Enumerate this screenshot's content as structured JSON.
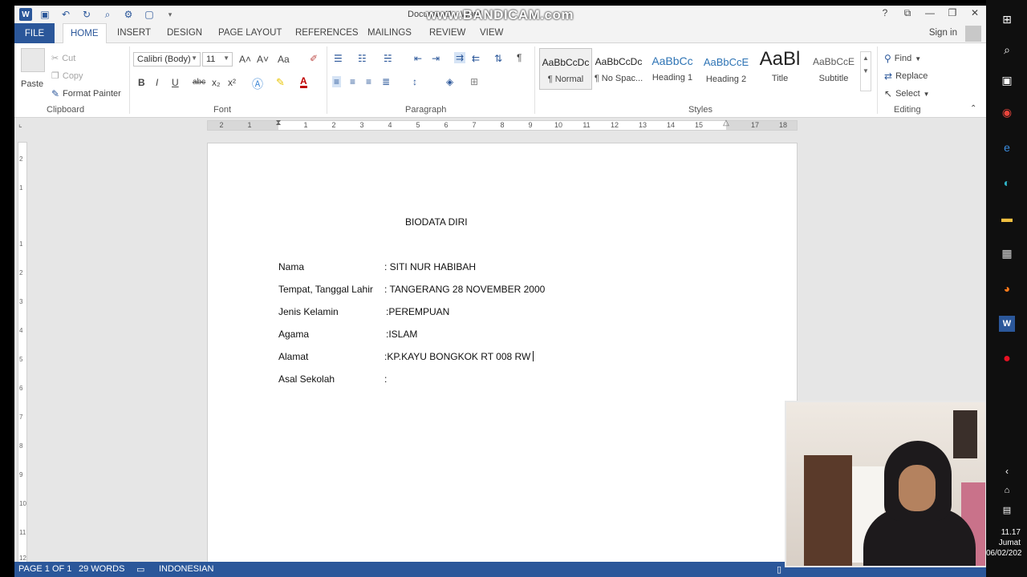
{
  "window": {
    "title": "Document1 - Word",
    "watermark": "www.BANDICAM.com",
    "controls": [
      "?",
      "⧉",
      "—",
      "❐",
      "✕"
    ]
  },
  "tabs": {
    "file": "FILE",
    "items": [
      "HOME",
      "INSERT",
      "DESIGN",
      "PAGE LAYOUT",
      "REFERENCES",
      "MAILINGS",
      "REVIEW",
      "VIEW"
    ],
    "signin": "Sign in"
  },
  "ribbon": {
    "clipboard": {
      "label": "Clipboard",
      "paste": "Paste",
      "cut": "Cut",
      "copy": "Copy",
      "format_painter": "Format Painter"
    },
    "font": {
      "label": "Font",
      "name": "Calibri (Body)",
      "size": "11",
      "bold": "B",
      "italic": "I",
      "underline": "U",
      "strike": "abc",
      "sub": "x₂",
      "sup": "x²",
      "grow": "A˄",
      "shrink": "A˅",
      "case": "Aa",
      "color": "A"
    },
    "paragraph": {
      "label": "Paragraph",
      "pilcrow": "¶"
    },
    "styles": {
      "label": "Styles",
      "items": [
        {
          "preview": "AaBbCcDc",
          "name": "¶ Normal"
        },
        {
          "preview": "AaBbCcDc",
          "name": "¶ No Spac..."
        },
        {
          "preview": "AaBbCc",
          "name": "Heading 1"
        },
        {
          "preview": "AaBbCcE",
          "name": "Heading 2"
        },
        {
          "preview": "AaBl",
          "name": "Title"
        },
        {
          "preview": "AaBbCcE",
          "name": "Subtitle"
        }
      ]
    },
    "editing": {
      "label": "Editing",
      "find": "Find",
      "replace": "Replace",
      "select": "Select"
    }
  },
  "ruler": {
    "ticks": [
      "2",
      "1",
      "1",
      "2",
      "3",
      "4",
      "5",
      "6",
      "7",
      "8",
      "9",
      "10",
      "11",
      "12",
      "13",
      "14",
      "15",
      "17",
      "18"
    ]
  },
  "vruler": {
    "ticks": [
      "2",
      "1",
      "1",
      "2",
      "3",
      "4",
      "5",
      "6",
      "7",
      "8",
      "9",
      "10",
      "11",
      "12"
    ]
  },
  "document": {
    "heading": "BIODATA DIRI",
    "fields": [
      {
        "label": "Nama",
        "value": ": SITI NUR HABIBAH"
      },
      {
        "label": "Tempat, Tanggal Lahir",
        "value": ": TANGERANG 28 NOVEMBER 2000"
      },
      {
        "label": "Jenis Kelamin",
        "value": ":PEREMPUAN"
      },
      {
        "label": "Agama",
        "value": ":ISLAM"
      },
      {
        "label": "Alamat",
        "value": ":KP.KAYU BONGKOK RT 008 RW"
      },
      {
        "label": "Asal Sekolah",
        "value": ":"
      }
    ]
  },
  "status": {
    "page": "PAGE 1 OF 1",
    "words": "29 WORDS",
    "language": "INDONESIAN"
  },
  "clock": {
    "time": "11.17",
    "day": "Jumat",
    "date": "06/02/202"
  }
}
